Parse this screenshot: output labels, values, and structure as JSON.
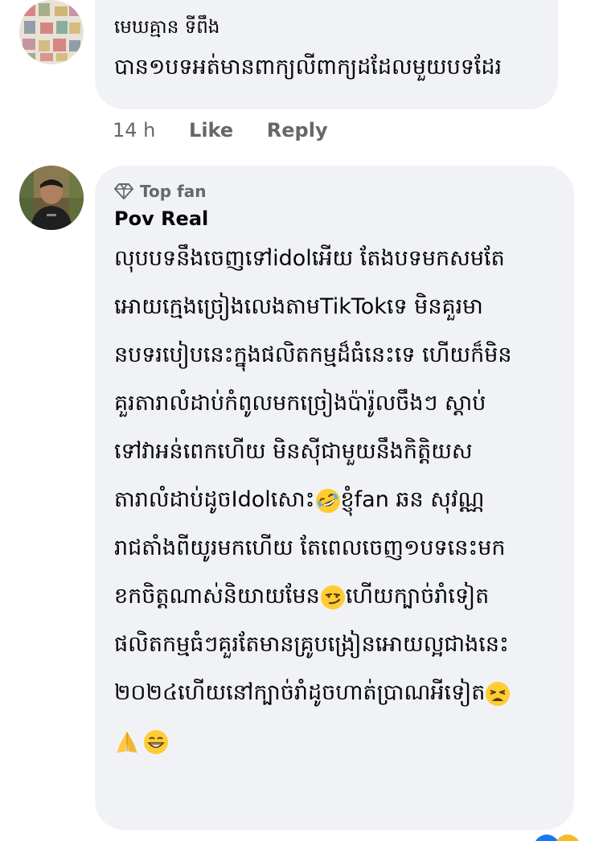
{
  "comment1": {
    "author": "មេឃគ្មាន ទីពឹង",
    "text": "បាន១បទអត់មានពាក្យលីពាក្យដដែលមួយបទដែរ",
    "time": "14 h",
    "like_label": "Like",
    "reply_label": "Reply"
  },
  "comment2": {
    "badge": "Top fan",
    "author": "Pov Real",
    "lines": [
      "លុបបទនឹងចេញទៅidolអើយ តែងបទមកសមតែ",
      "អោយក្មេងច្រៀងលេងតាមTikTokទេ មិនគួរមា",
      "នបទរបៀបនេះក្នុងផលិតកម្មដ៏ធំនេះទេ ហើយក៏មិន",
      "គួរតារាលំដាប់កំពូលមកច្រៀងប៉ារ៉ូលចឹងៗ ស្តាប់",
      "ទៅវាអន់ពេកហើយ មិនស៊ីជាមួយនឹងកិត្តិយស",
      "តារាលំដាប់ដូចIdolសោះ",
      "ខ្ញុំfan ឆន សុវណ្ណ",
      "រាជតាំងពីយូរមកហើយ តែពេលចេញ១បទនេះមក",
      "ខកចិត្តណាស់និយាយមែន",
      "ហើយក្បាច់រាំទៀត",
      "ផលិតកម្មធំៗគួរតែមានគ្រូបង្រៀនអោយល្អជាងនេះ",
      "២០២៤ហើយនៅក្បាច់រាំដូចហាត់ប្រាណអីទៀត"
    ]
  },
  "icons": {
    "top_fan": "diamond-icon",
    "emoji_rofl": "rofl-emoji-icon",
    "emoji_smirk": "smirk-emoji-icon",
    "emoji_weary": "weary-emoji-icon",
    "emoji_pray": "pray-emoji-icon",
    "emoji_grin": "grin-emoji-icon"
  },
  "colors": {
    "bubble": "#f0f2f5",
    "muted": "#65676b",
    "text": "#050505"
  }
}
